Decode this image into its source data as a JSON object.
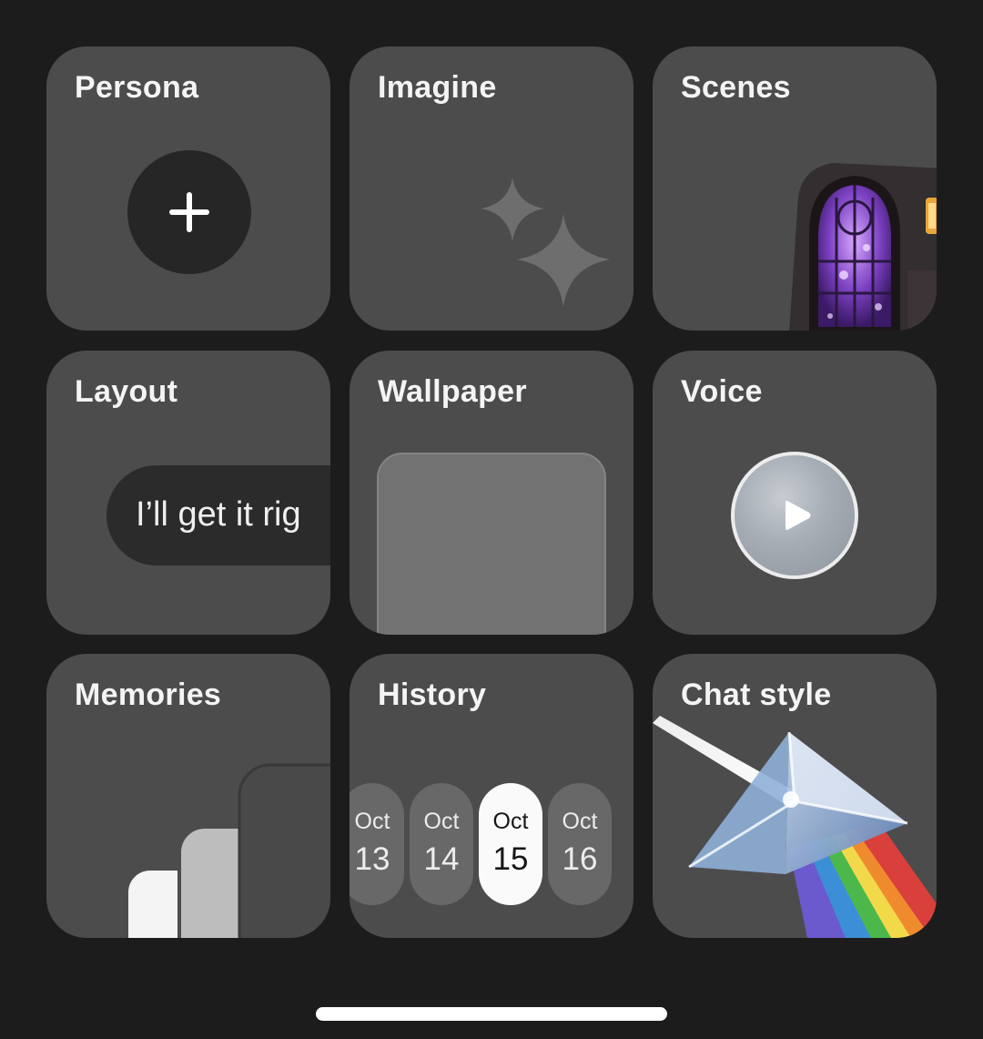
{
  "tiles": {
    "persona": {
      "title": "Persona",
      "icon": "plus-icon"
    },
    "imagine": {
      "title": "Imagine",
      "icon": "sparkles-icon"
    },
    "scenes": {
      "title": "Scenes",
      "image": "stained-glass-window-scene"
    },
    "layout": {
      "title": "Layout",
      "preview_text": "I’ll get it rig"
    },
    "wallpaper": {
      "title": "Wallpaper"
    },
    "voice": {
      "title": "Voice",
      "icon": "play-icon"
    },
    "memories": {
      "title": "Memories"
    },
    "history": {
      "title": "History",
      "dates": [
        {
          "month": "Oct",
          "day": "13",
          "selected": false
        },
        {
          "month": "Oct",
          "day": "14",
          "selected": false
        },
        {
          "month": "Oct",
          "day": "15",
          "selected": true
        },
        {
          "month": "Oct",
          "day": "16",
          "selected": false
        }
      ]
    },
    "chat_style": {
      "title": "Chat style",
      "image": "prism-rainbow"
    }
  },
  "colors": {
    "background": "#1d1c1d",
    "tile": "#4d4c4d",
    "selected_date": "#fafafa"
  }
}
